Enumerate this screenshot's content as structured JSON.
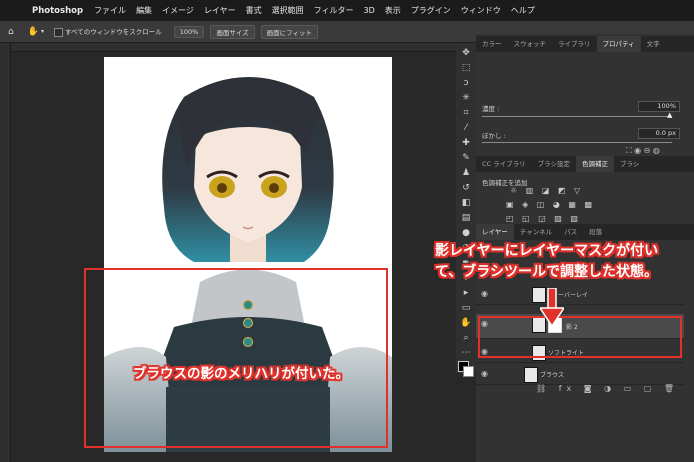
{
  "menubar": {
    "apple": "",
    "app_name": "Photoshop",
    "items": [
      "ファイル",
      "編集",
      "イメージ",
      "レイヤー",
      "書式",
      "選択範囲",
      "フィルター",
      "3D",
      "表示",
      "プラグイン",
      "ウィンドウ",
      "ヘルプ"
    ]
  },
  "options_bar": {
    "scroll_all_label": "すべてのウィンドウをスクロール",
    "zoom_btn": "100%",
    "fit_screen_btn": "画面サイズ",
    "fill_screen_btn": "画面にフィット"
  },
  "panels": {
    "top_tabs": [
      "カラー",
      "スウォッチ",
      "ライブラリ",
      "プロパティ",
      "文字"
    ],
    "top_active": "プロパティ",
    "density_label": "濃度 :",
    "density_value": "100%",
    "feather_label": "ぼかし :",
    "feather_value": "0.0 px",
    "mid_tabs": [
      "CC ライブラリ",
      "ブラシ設定",
      "色調補正",
      "ブラシ"
    ],
    "mid_active": "色調補正",
    "adjust_add_label": "色調補正を追加",
    "layer_tabs": [
      "レイヤー",
      "チャンネル",
      "パス",
      "段落"
    ],
    "layer_active": "レイヤー",
    "layers": [
      {
        "name": "オーバーレイ"
      },
      {
        "name": "影 2"
      },
      {
        "name": "ソフトライト"
      },
      {
        "name": "ブラウス"
      }
    ]
  },
  "annotations": {
    "right_line1": "影レイヤーにレイヤーマスクが付い",
    "right_line2": "て、ブラシツールで調整した状態。",
    "left_text": "ブラウスの影のメリハリが付いた。"
  },
  "colors": {
    "accent_red": "#e0312b",
    "app_bg": "#282828",
    "panel_bg": "#323232"
  }
}
